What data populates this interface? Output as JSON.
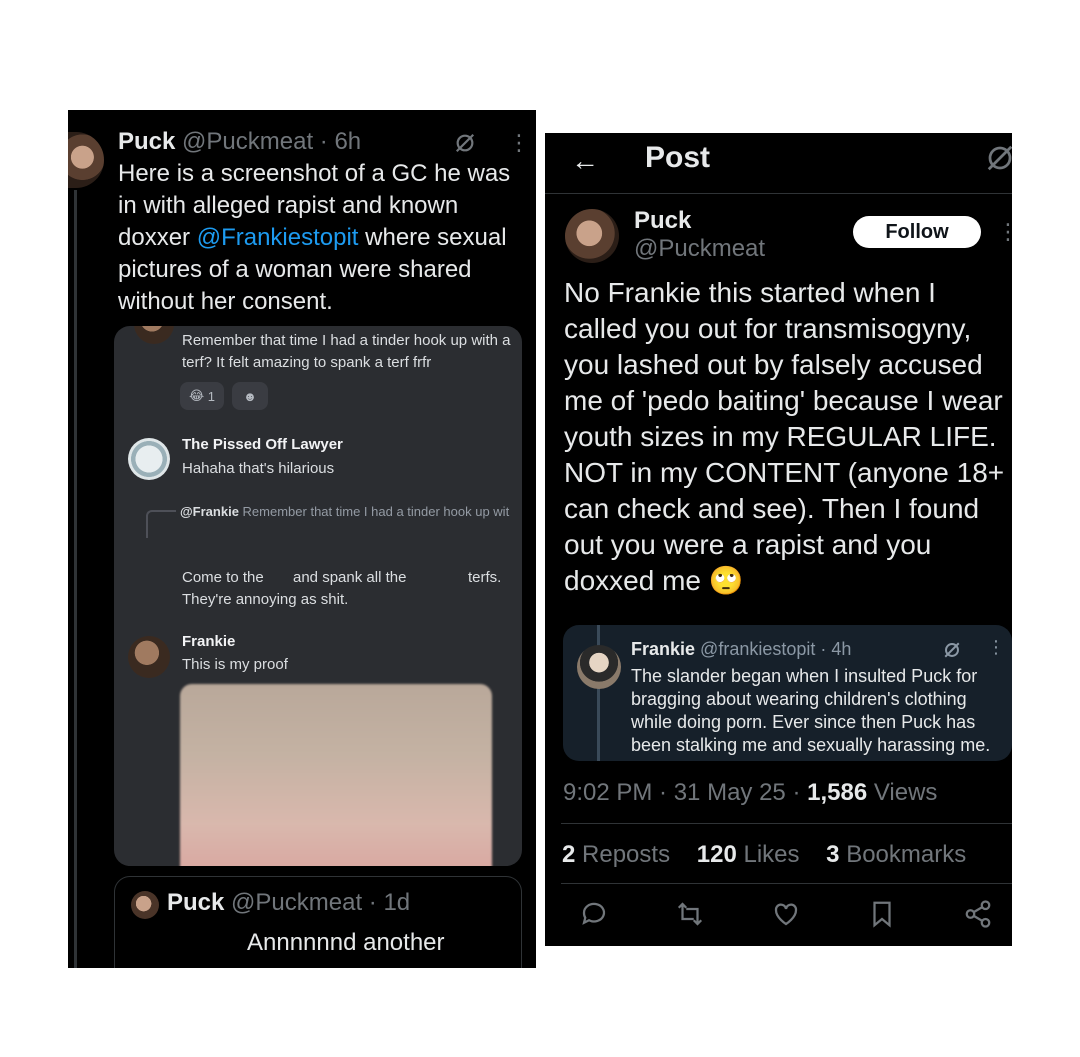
{
  "left_tweet": {
    "name": "Puck",
    "meta": "@Puckmeat · 6h",
    "text_before": "Here is a screenshot of a GC he was in with alleged rapist and known doxxer ",
    "mention": "@Frankiestopit",
    "text_after": " where sexual pictures of a woman were shared without her consent.",
    "discord": {
      "msg1": "Remember that time I had a tinder hook up with a terf? It felt amazing to spank a terf frfr",
      "reaction_emoji": "😂",
      "reaction_count": "1",
      "add_reaction": "☻",
      "user2_name": "The Pissed Off Lawyer",
      "user2_text": "Hahaha that's hilarious",
      "reply_author": "@Frankie",
      "reply_snippet": "Remember that time I had a tinder hook up with a terf? It felt amazing to spank a terf ...",
      "msg3_a": "Come to the",
      "msg3_b": "and spank all the",
      "msg3_c": "terfs.",
      "msg3_d": "They're annoying as shit.",
      "user3_name": "Frankie",
      "user3_text": "This is my proof"
    },
    "quote2": {
      "name": "Puck",
      "meta": "@Puckmeat · 1d",
      "text": "Annnnnnd another"
    }
  },
  "right_post": {
    "title": "Post",
    "name": "Puck",
    "handle": "@Puckmeat",
    "follow_label": "Follow",
    "text": "No Frankie this started when I called you out for transmisogyny, you lashed out by falsely accused me of 'pedo baiting' because I wear youth sizes in my REGULAR LIFE. NOT in my CONTENT (anyone 18+ can check and see). Then I found out you were a rapist and you doxxed me 🙄",
    "quote": {
      "name": "Frankie",
      "meta": "@frankiestopit · 4h",
      "text": "The slander began when I insulted Puck for bragging about wearing children's clothing while doing porn. Ever since then Puck has been stalking me and sexually harassing me."
    },
    "timestamp": "9:02 PM · 31 May 25 · ",
    "views_count": "1,586",
    "views_label": " Views",
    "reposts_count": "2",
    "reposts_label": " Reposts",
    "likes_count": "120",
    "likes_label": " Likes",
    "bookmarks_count": "3",
    "bookmarks_label": " Bookmarks"
  },
  "colors": {
    "background": "#000000",
    "link": "#1d9bf0",
    "secondary_text": "#71767b",
    "discord_bg": "#2b2d31"
  }
}
